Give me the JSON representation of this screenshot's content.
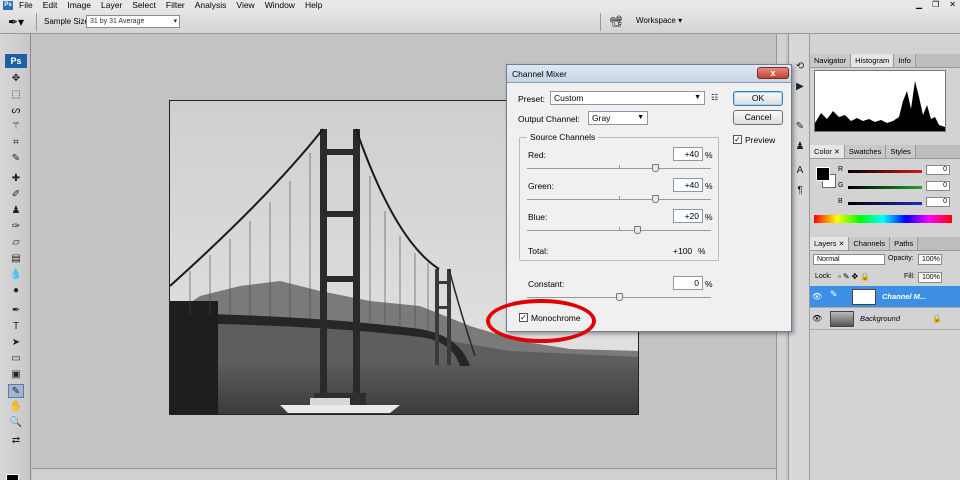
{
  "menubar": {
    "logo": "Ps",
    "items": [
      "File",
      "Edit",
      "Image",
      "Layer",
      "Select",
      "Filter",
      "Analysis",
      "View",
      "Window",
      "Help"
    ]
  },
  "options_bar": {
    "sample_size_label": "Sample Size:",
    "sample_size_value": "31 by 31 Average",
    "workspace_label": "Workspace ▾"
  },
  "toolbox": {
    "logo": "Ps"
  },
  "panels": {
    "top_tabs": [
      "Navigator",
      "Histogram",
      "Info"
    ],
    "color_tabs": [
      "Color",
      "Swatches",
      "Styles"
    ],
    "color": {
      "channels": [
        {
          "label": "R",
          "value": "0",
          "color": "#d21a1a"
        },
        {
          "label": "G",
          "value": "0",
          "color": "#1ea32e"
        },
        {
          "label": "B",
          "value": "0",
          "color": "#1d2fb8"
        }
      ]
    },
    "layer_tabs": [
      "Layers",
      "Channels",
      "Paths"
    ],
    "layers": {
      "blend_mode": "Normal",
      "opacity_label": "Opacity:",
      "opacity_value": "100%",
      "lock_label": "Lock:",
      "fill_label": "Fill:",
      "fill_value": "100%",
      "items": [
        {
          "name": "Channel M...",
          "selected": true
        },
        {
          "name": "Background",
          "selected": false
        }
      ]
    }
  },
  "dialog": {
    "title": "Channel Mixer",
    "close": "x",
    "preset_label": "Preset:",
    "preset_value": "Custom",
    "output_label": "Output Channel:",
    "output_value": "Gray",
    "ok": "OK",
    "cancel": "Cancel",
    "preview_label": "Preview",
    "preview_checked": true,
    "source_label": "Source Channels",
    "channels": [
      {
        "label": "Red:",
        "value": "+40",
        "unit": "%",
        "pct": 0.7
      },
      {
        "label": "Green:",
        "value": "+40",
        "unit": "%",
        "pct": 0.7
      },
      {
        "label": "Blue:",
        "value": "+20",
        "unit": "%",
        "pct": 0.6
      }
    ],
    "total_label": "Total:",
    "total_value": "+100",
    "total_unit": "%",
    "constant_label": "Constant:",
    "constant_value": "0",
    "constant_unit": "%",
    "constant_pct": 0.5,
    "monochrome_label": "Monochrome",
    "monochrome_checked": true
  },
  "colors": {
    "accent_selected": "#3d8fe6",
    "annotation": "#e00000"
  }
}
